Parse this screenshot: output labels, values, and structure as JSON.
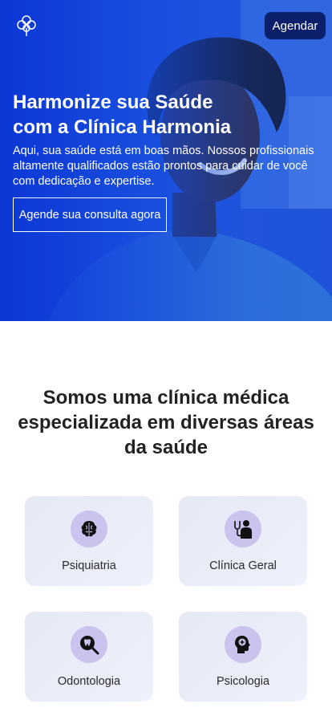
{
  "header": {
    "logo_icon": "tree-logo-icon",
    "schedule_button": "Agendar"
  },
  "hero": {
    "title": "Harmonize sua Saúde com a Clínica Harmonia",
    "text": "Aqui, sua saúde está em boas mãos. Nossos profissionais altamente qualificados estão prontos para cuidar de você com dedicação e expertise.",
    "cta": "Agende sua consulta agora",
    "accent_color": "#1f56e2"
  },
  "specialties": {
    "title": "Somos uma clínica médica especializada em diversas áreas da saúde",
    "cards": [
      {
        "label": "Psiquiatria",
        "icon": "brain-icon"
      },
      {
        "label": "Clínica Geral",
        "icon": "doctor-stethoscope-icon"
      },
      {
        "label": "Odontologia",
        "icon": "tooth-search-icon"
      },
      {
        "label": "Psicologia",
        "icon": "head-plus-icon"
      }
    ]
  }
}
